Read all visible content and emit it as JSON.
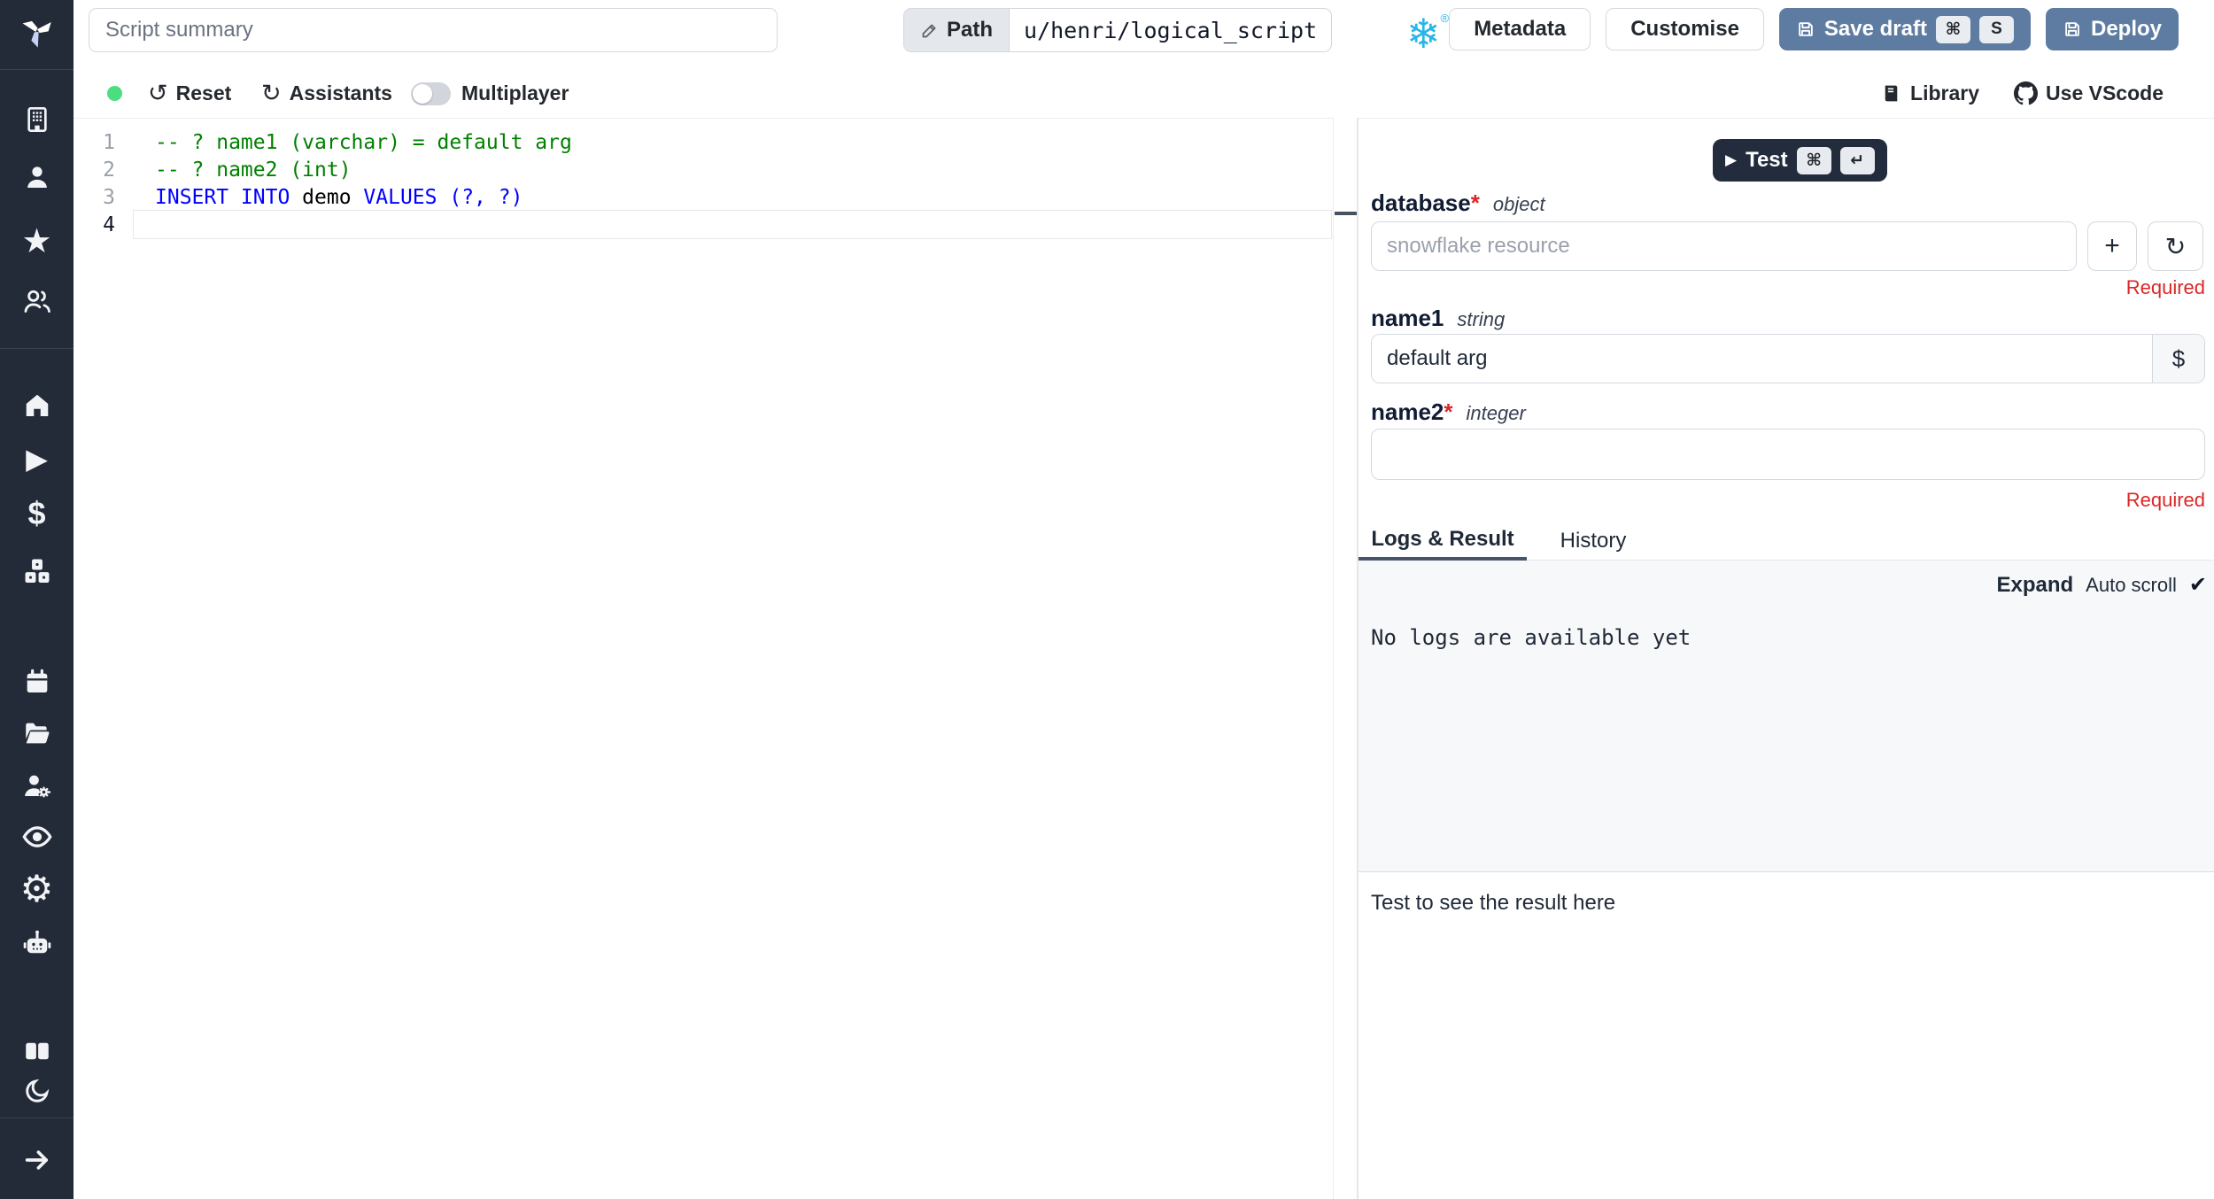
{
  "colors": {
    "sidebar_bg": "#232a38",
    "action_blue": "#5e7ca2",
    "dark_button": "#222c3d",
    "required_red": "#dc2626",
    "comment_green": "#008000",
    "keyword_blue": "#0000ff",
    "snowflake_blue": "#29b5e8",
    "online_green": "#4ade80"
  },
  "icons": {
    "reset": "↺",
    "refresh": "↻",
    "rotate_cw": "↻",
    "plus": "+",
    "snowflake": "❄",
    "registered": "®",
    "star": "★",
    "dollar": "$",
    "play": "▶",
    "settings_gear": "⚙"
  },
  "topbar": {
    "summary_placeholder": "Script summary",
    "path_label": "Path",
    "path_value": "u/henri/logical_script",
    "buttons": {
      "metadata": "Metadata",
      "customise": "Customise",
      "save_draft": "Save draft",
      "deploy": "Deploy"
    },
    "save_draft_kbd": [
      "⌘",
      "S"
    ]
  },
  "toolbar": {
    "reset": "Reset",
    "assistants": "Assistants",
    "multiplayer": "Multiplayer",
    "multiplayer_enabled": false,
    "library": "Library",
    "use_vscode": "Use VScode"
  },
  "editor": {
    "lines": [
      {
        "num": "1",
        "comment": "-- ? name1 (varchar) = default arg"
      },
      {
        "num": "2",
        "comment": "-- ? name2 (int)"
      },
      {
        "num": "3",
        "kw1": "INSERT INTO",
        "ident": " demo ",
        "kw2": "VALUES",
        "tail": " (?, ?)"
      },
      {
        "num": "4"
      }
    ]
  },
  "run_panel": {
    "test": {
      "label": "Test",
      "kbd": [
        "⌘",
        "↵"
      ]
    },
    "database": {
      "label": "database",
      "star": "*",
      "type": "object",
      "placeholder": "snowflake resource",
      "required": "Required"
    },
    "name1": {
      "label": "name1",
      "type": "string",
      "value": "default arg",
      "suffix": "$"
    },
    "name2": {
      "label": "name2",
      "star": "*",
      "type": "integer",
      "required": "Required"
    },
    "tabs": {
      "logs": "Logs & Result",
      "history": "History"
    },
    "logs": {
      "expand": "Expand",
      "autoscroll": "Auto scroll",
      "check": "✔",
      "empty": "No logs are available yet"
    },
    "result_hint": "Test to see the result here"
  }
}
